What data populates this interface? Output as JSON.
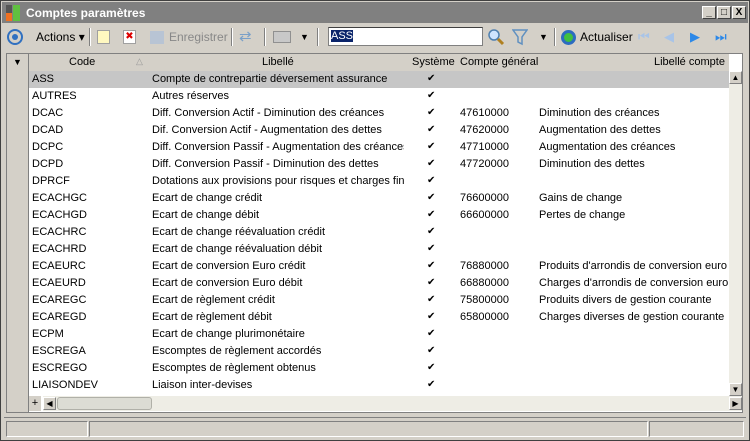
{
  "window": {
    "title": "Comptes paramètres",
    "min": "_",
    "max": "□",
    "close": "X"
  },
  "toolbar": {
    "actions": "Actions",
    "save": "Enregistrer",
    "search_value": "ASS",
    "refresh": "Actualiser"
  },
  "columns": {
    "code": "Code",
    "libelle": "Libellé",
    "systeme": "Système",
    "compte": "Compte général",
    "libelle_compte": "Libellé compte"
  },
  "rows": [
    {
      "code": "ASS",
      "libelle": "Compte de contrepartie déversement assurance",
      "sys": "✔",
      "compte": "",
      "lib": ""
    },
    {
      "code": "AUTRES",
      "libelle": "Autres réserves",
      "sys": "✔",
      "compte": "",
      "lib": ""
    },
    {
      "code": "DCAC",
      "libelle": "Diff. Conversion Actif - Diminution des créances",
      "sys": "✔",
      "compte": "47610000",
      "lib": "Diminution des créances"
    },
    {
      "code": "DCAD",
      "libelle": "Dif. Conversion Actif - Augmentation des dettes",
      "sys": "✔",
      "compte": "47620000",
      "lib": "Augmentation des dettes"
    },
    {
      "code": "DCPC",
      "libelle": "Diff. Conversion Passif - Augmentation des créances",
      "sys": "✔",
      "compte": "47710000",
      "lib": "Augmentation des créances"
    },
    {
      "code": "DCPD",
      "libelle": "Diff. Conversion Passif - Diminution des dettes",
      "sys": "✔",
      "compte": "47720000",
      "lib": "Diminution des dettes"
    },
    {
      "code": "DPRCF",
      "libelle": "Dotations aux provisions pour risques et charges fina",
      "sys": "✔",
      "compte": "",
      "lib": ""
    },
    {
      "code": "ECACHGC",
      "libelle": "Ecart de change crédit",
      "sys": "✔",
      "compte": "76600000",
      "lib": "Gains de change"
    },
    {
      "code": "ECACHGD",
      "libelle": "Ecart de change débit",
      "sys": "✔",
      "compte": "66600000",
      "lib": "Pertes de change"
    },
    {
      "code": "ECACHRC",
      "libelle": "Ecart de change réévaluation crédit",
      "sys": "✔",
      "compte": "",
      "lib": ""
    },
    {
      "code": "ECACHRD",
      "libelle": "Ecart de change réévaluation débit",
      "sys": "✔",
      "compte": "",
      "lib": ""
    },
    {
      "code": "ECAEURC",
      "libelle": "Ecart de conversion Euro crédit",
      "sys": "✔",
      "compte": "76880000",
      "lib": "Produits d'arrondis de conversion euro"
    },
    {
      "code": "ECAEURD",
      "libelle": "Ecart de conversion Euro débit",
      "sys": "✔",
      "compte": "66880000",
      "lib": "Charges d'arrondis de conversion euro"
    },
    {
      "code": "ECAREGC",
      "libelle": "Ecart de règlement crédit",
      "sys": "✔",
      "compte": "75800000",
      "lib": "Produits divers de gestion courante"
    },
    {
      "code": "ECAREGD",
      "libelle": "Ecart de règlement débit",
      "sys": "✔",
      "compte": "65800000",
      "lib": "Charges diverses de gestion courante"
    },
    {
      "code": "ECPM",
      "libelle": "Ecart de change plurimonétaire",
      "sys": "✔",
      "compte": "",
      "lib": ""
    },
    {
      "code": "ESCREGA",
      "libelle": "Escomptes de règlement accordés",
      "sys": "✔",
      "compte": "",
      "lib": ""
    },
    {
      "code": "ESCREGO",
      "libelle": "Escomptes de règlement obtenus",
      "sys": "✔",
      "compte": "",
      "lib": ""
    },
    {
      "code": "LIAISONDEV",
      "libelle": "Liaison inter-devises",
      "sys": "✔",
      "compte": "",
      "lib": ""
    }
  ],
  "grid": {
    "add": "+"
  }
}
